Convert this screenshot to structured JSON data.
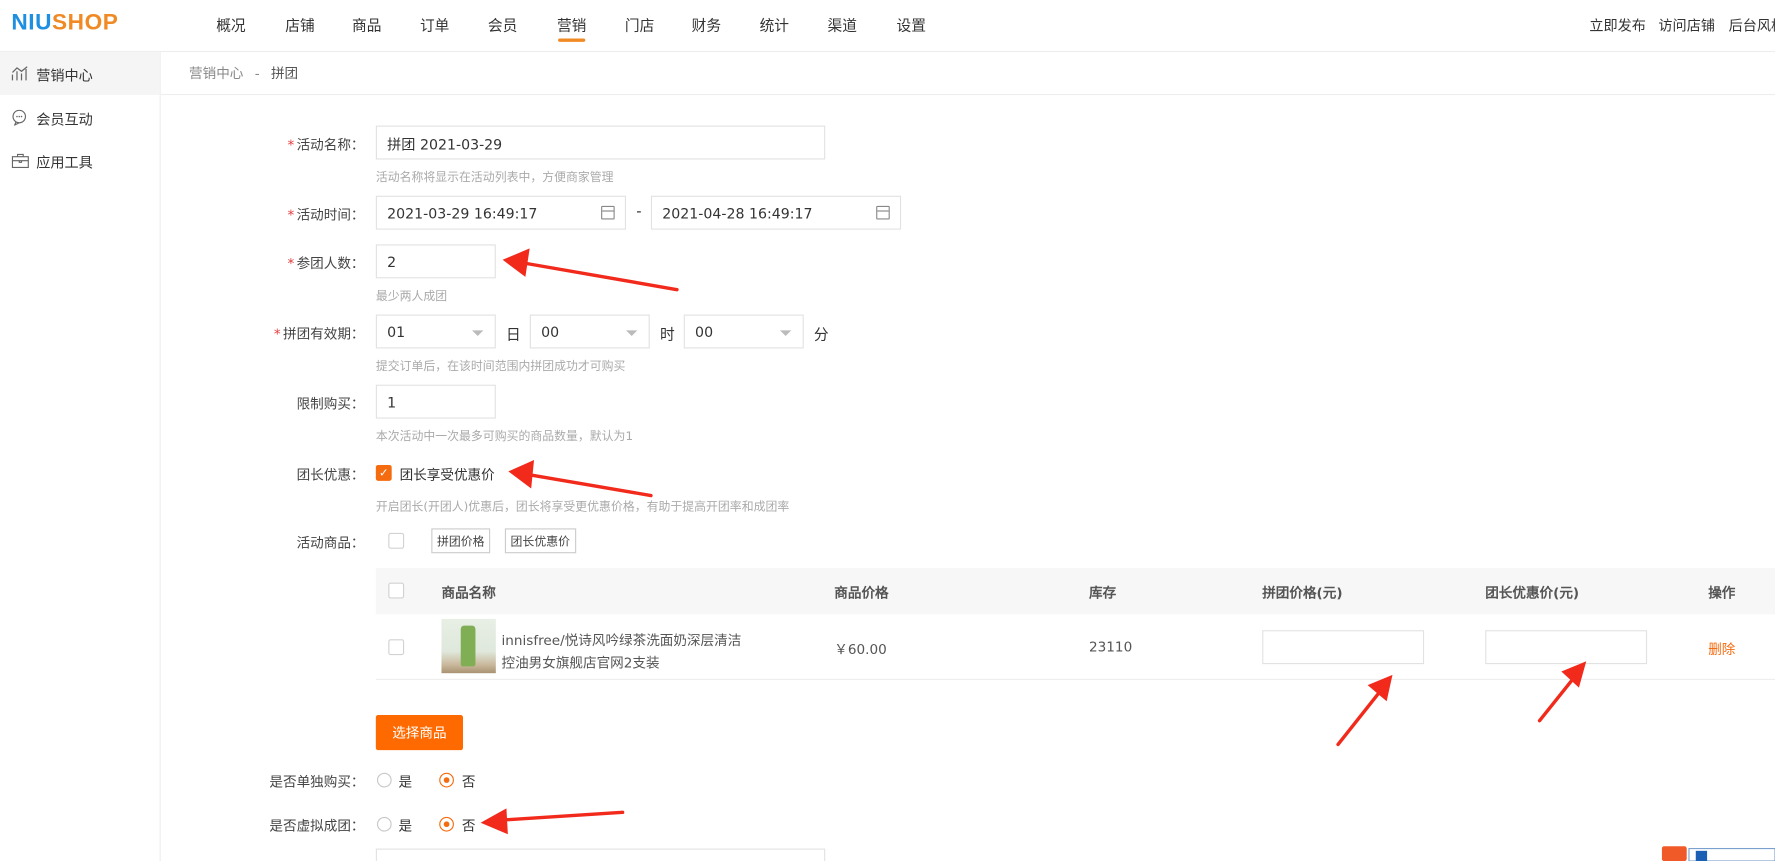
{
  "header": {
    "logo": {
      "part1": "NIU",
      "part2": "SHOP",
      "full": "NIUSHOP"
    },
    "nav": [
      "概况",
      "店铺",
      "商品",
      "订单",
      "会员",
      "营销",
      "门店",
      "财务",
      "统计",
      "渠道",
      "设置"
    ],
    "active_nav": "营销",
    "right_links": [
      "立即发布",
      "访问店铺",
      "后台风格"
    ]
  },
  "sidebar": {
    "items": [
      {
        "label": "营销中心",
        "icon": "chart-icon",
        "active": true
      },
      {
        "label": "会员互动",
        "icon": "chat-icon",
        "active": false
      },
      {
        "label": "应用工具",
        "icon": "toolbox-icon",
        "active": false
      }
    ]
  },
  "breadcrumb": {
    "parent": "营销中心",
    "sep": "-",
    "current": "拼团"
  },
  "form": {
    "name": {
      "label": "活动名称：",
      "value": "拼团 2021-03-29",
      "hint": "活动名称将显示在活动列表中，方便商家管理"
    },
    "time": {
      "label": "活动时间：",
      "start": "2021-03-29 16:49:17",
      "sep": "-",
      "end": "2021-04-28 16:49:17"
    },
    "group_size": {
      "label": "参团人数：",
      "value": "2",
      "hint": "最少两人成团"
    },
    "validity": {
      "label": "拼团有效期：",
      "day": "01",
      "day_unit": "日",
      "hour": "00",
      "hour_unit": "时",
      "minute": "00",
      "minute_unit": "分",
      "hint": "提交订单后，在该时间范围内拼团成功才可购买"
    },
    "limit": {
      "label": "限制购买：",
      "value": "1",
      "hint": "本次活动中一次最多可购买的商品数量，默认为1"
    },
    "leader": {
      "label": "团长优惠：",
      "checkbox_label": "团长享受优惠价",
      "checked": true,
      "hint": "开启团长(开团人)优惠后，团长将享受更优惠价格，有助于提高开团率和成团率"
    },
    "goods": {
      "label": "活动商品：",
      "batch_buttons": [
        "拼团价格",
        "团长优惠价"
      ]
    },
    "table": {
      "columns": [
        "商品名称",
        "商品价格",
        "库存",
        "拼团价格(元)",
        "团长优惠价(元)",
        "操作"
      ],
      "rows": [
        {
          "name_line1": "innisfree/悦诗风吟绿茶洗面奶深层清洁",
          "name_line2": "控油男女旗舰店官网2支装",
          "price": "￥60.00",
          "stock": "23110",
          "group_price": "",
          "leader_price": "",
          "action": "删除"
        }
      ]
    },
    "select_goods_button": "选择商品",
    "single_buy": {
      "label": "是否单独购买：",
      "options": [
        "是",
        "否"
      ],
      "selected": "否"
    },
    "virtual_group": {
      "label": "是否虚拟成团：",
      "options": [
        "是",
        "否"
      ],
      "selected": "否"
    }
  },
  "colors": {
    "accent": "#ff6a00",
    "annotation": "#f22a1c",
    "logo_blue": "#1e8fe1",
    "logo_orange": "#f08a24"
  }
}
